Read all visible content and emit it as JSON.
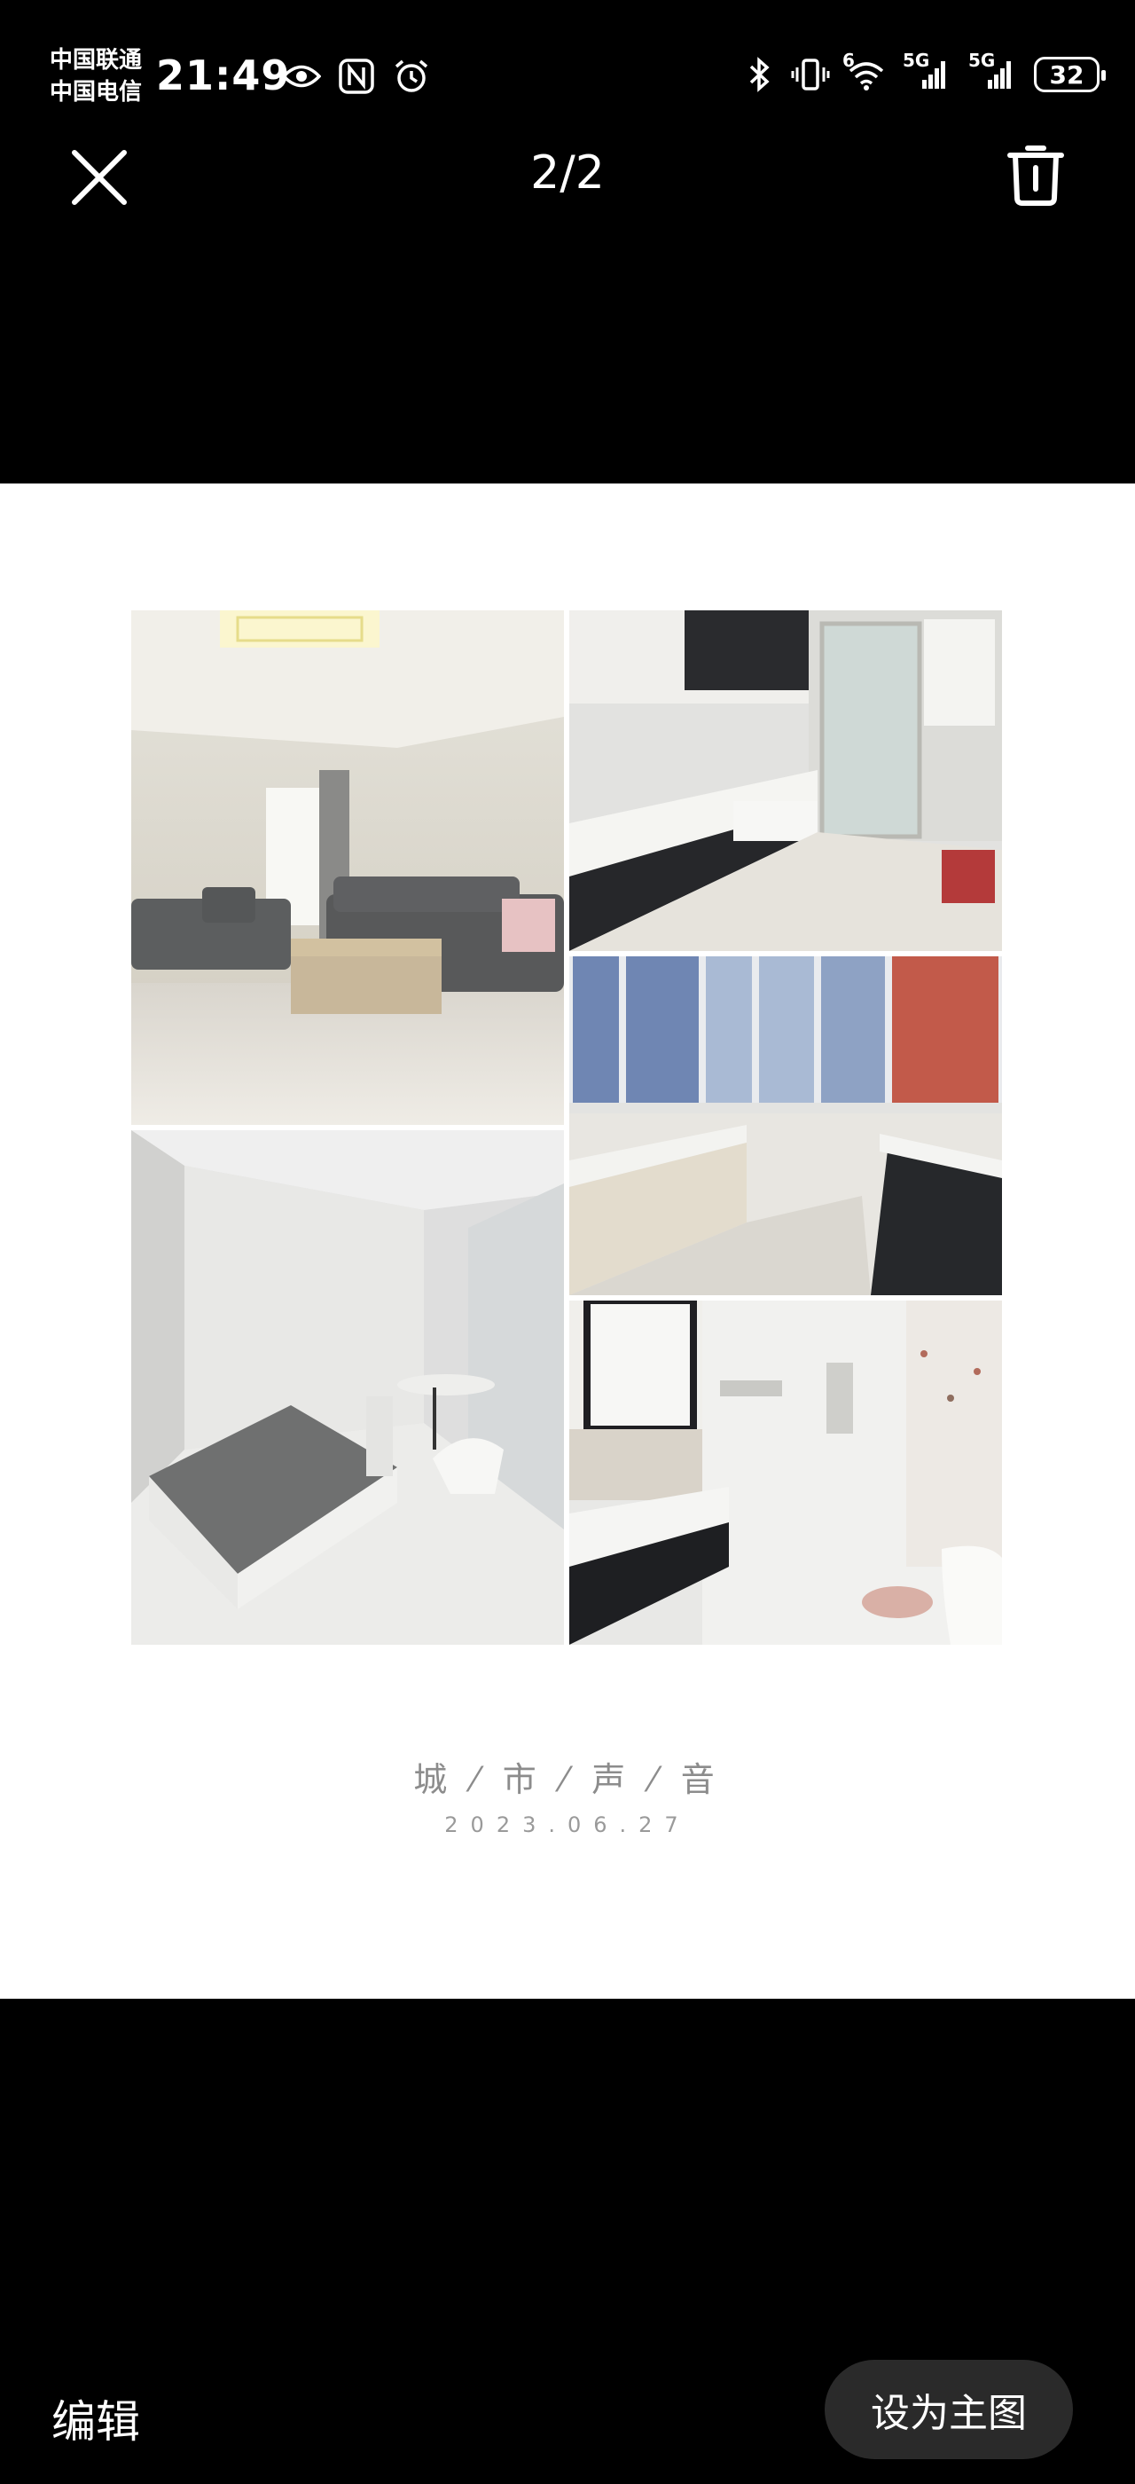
{
  "status_bar": {
    "carrier_1": "中国联通",
    "carrier_2": "中国电信",
    "time": "21:49",
    "left_icons": [
      "eye-icon",
      "nfc-icon",
      "alarm-icon"
    ],
    "right_icons": [
      "bluetooth-icon",
      "vibrate-icon",
      "wifi-icon",
      "signal-icon",
      "signal-icon"
    ],
    "wifi_label": "6",
    "sim1_label": "5G",
    "sim2_label": "5G",
    "battery": "32"
  },
  "nav": {
    "counter": "2/2",
    "close_icon": "close-icon",
    "delete_icon": "trash-icon"
  },
  "photo": {
    "tiles": [
      "living-room",
      "kitchen",
      "bedroom",
      "balcony",
      "bathroom"
    ],
    "caption": "城 ⁄ 市 ⁄ 声 ⁄ 音",
    "date": "2023.06.27"
  },
  "bottom": {
    "edit_label": "编辑",
    "set_main_label": "设为主图"
  },
  "colors": {
    "background": "#000000",
    "photo_bg": "#ffffff",
    "pill_button": "#2a2a2a"
  }
}
